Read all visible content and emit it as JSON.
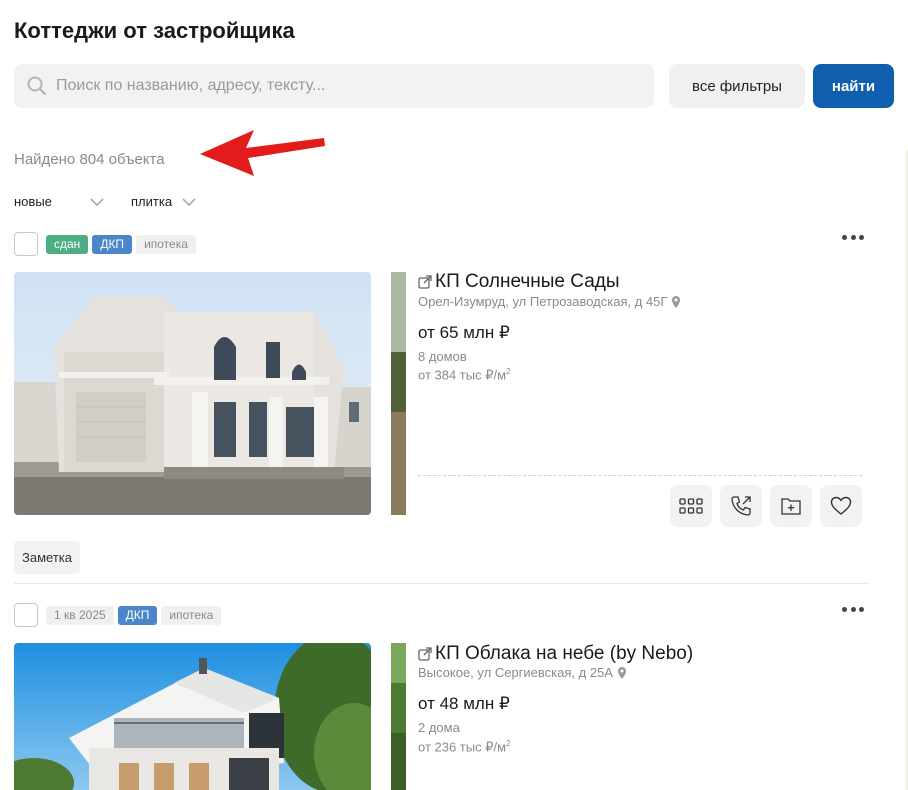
{
  "page": {
    "title": "Коттеджи от застройщика",
    "search_placeholder": "Поиск по названию, адресу, тексту...",
    "filters_label": "все фильтры",
    "find_label": "найти",
    "found_text": "Найдено 804 объекта",
    "sort_label": "новые",
    "view_label": "плитка",
    "note_label": "Заметка"
  },
  "listings": [
    {
      "tags": [
        "сдан",
        "ДКП",
        "ипотека"
      ],
      "title": "КП Солнечные Сады",
      "address": "Орел-Изумруд, ул Петрозаводская, д 45Г",
      "price": "от 65 млн ₽",
      "houses": "8 домов",
      "price_per_m": "от 384 тыс ₽/м",
      "price_per_m_sup": "2"
    },
    {
      "tags": [
        "1 кв 2025",
        "ДКП",
        "ипотека"
      ],
      "title": "КП Облака на небе (by Nebo)",
      "address": "Высокое, ул Сергиевская, д 25А",
      "price": "от 48 млн ₽",
      "houses": "2 дома",
      "price_per_m": "от 236 тыс ₽/м",
      "price_per_m_sup": "2"
    }
  ],
  "colors": {
    "accent": "#0f5fae",
    "tag_green": "#4caf84",
    "tag_blue": "#4a86c8",
    "arrow": "#e21b1b"
  },
  "icons": [
    "search-icon",
    "chevron-down-icon",
    "external-link-icon",
    "map-pin-icon",
    "grid-icon",
    "phone-icon",
    "folder-add-icon",
    "heart-icon",
    "more-dots-icon",
    "red-arrow-annotation"
  ]
}
